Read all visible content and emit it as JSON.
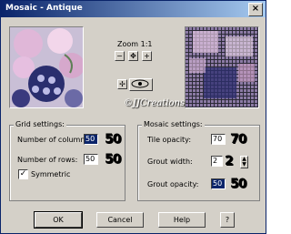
{
  "window": {
    "title": "Mosaic - Antique",
    "close_label": "×"
  },
  "preview": {
    "zoom_label": "Zoom 1:1"
  },
  "watermark": {
    "text": "©JJCreations"
  },
  "grid_settings": {
    "title": "Grid settings:",
    "columns_label": "Number of columns:",
    "columns_value": "50",
    "columns_big": "50",
    "rows_label": "Number of rows:",
    "rows_value": "50",
    "rows_big": "50",
    "symmetric_label": "Symmetric",
    "symmetric_checked": "✓"
  },
  "mosaic_settings": {
    "title": "Mosaic settings:",
    "tile_opacity_label": "Tile opacity:",
    "tile_opacity_value": "70",
    "tile_opacity_big": "70",
    "grout_width_label": "Grout width:",
    "grout_width_value": "2",
    "grout_width_big": "2",
    "grout_opacity_label": "Grout opacity:",
    "grout_opacity_value": "50",
    "grout_opacity_big": "50"
  },
  "buttons": {
    "ok": "OK",
    "cancel": "Cancel",
    "help": "Help",
    "context_help": "?"
  },
  "toolbar_icons": [
    "zoom-out-icon",
    "pan-icon",
    "zoom-in-icon",
    "move-icon",
    "eye-icon"
  ]
}
